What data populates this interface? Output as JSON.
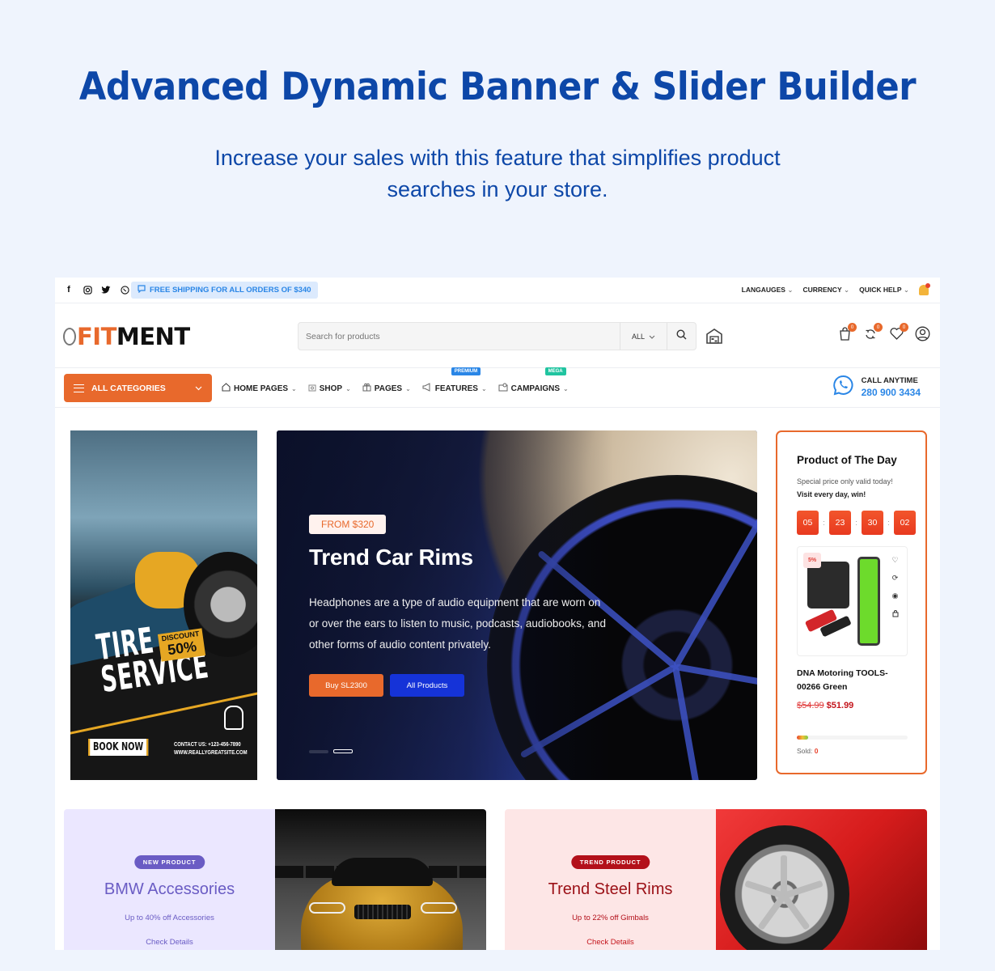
{
  "hero": {
    "title": "Advanced Dynamic Banner & Slider Builder",
    "subtitle": "Increase your sales with this feature that simplifies product searches in your store."
  },
  "topbar": {
    "social_icons": [
      "facebook-icon",
      "instagram-icon",
      "twitter-icon",
      "viber-icon"
    ],
    "shipping_notice": "FREE SHIPPING FOR ALL ORDERS OF $340",
    "menus": [
      "LANGAUGES",
      "CURRENCY",
      "QUICK HELP"
    ]
  },
  "header": {
    "logo_accent": "FIT",
    "logo_rest": "MENT",
    "search_placeholder": "Search for products",
    "search_category": "ALL",
    "cart_count": "0",
    "compare_count": "0",
    "wishlist_count": "0"
  },
  "nav": {
    "all_categories": "ALL CATEGORIES",
    "items": [
      {
        "label": "HOME PAGES",
        "tag": ""
      },
      {
        "label": "SHOP",
        "tag": ""
      },
      {
        "label": "PAGES",
        "tag": ""
      },
      {
        "label": "FEATURES",
        "tag": "PREMIUM"
      },
      {
        "label": "CAMPAIGNS",
        "tag": "MEGA"
      }
    ],
    "call_label": "CALL ANYTIME",
    "call_number": "280 900 3434"
  },
  "left_banner": {
    "title_line1": "TIRE",
    "title_line2": "SERVICE",
    "discount_label": "DISCOUNT",
    "discount_value": "50%",
    "book_now": "BOOK NOW",
    "contact_line1": "CONTACT US: +123-456-7890",
    "contact_line2": "WWW.REALLYGREATSITE.COM"
  },
  "slider": {
    "price_tag": "FROM $320",
    "title": "Trend Car Rims",
    "description": "Headphones are a type of audio equipment that are worn on or over the ears to listen to music, podcasts, audiobooks, and other forms of audio content privately.",
    "primary_button": "Buy SL2300",
    "secondary_button": "All Products",
    "slide_count": 2,
    "active_slide": 2
  },
  "product_of_day": {
    "heading": "Product of The Day",
    "line1": "Special price only valid today!",
    "line2": "Visit every day, win!",
    "countdown": [
      "05",
      "23",
      "30",
      "02"
    ],
    "discount_badge": "5%",
    "product_name": "DNA Motoring TOOLS-00266 Green",
    "old_price": "$54.99",
    "new_price": "$51.99",
    "sold_label": "Sold:",
    "sold_count": "0",
    "sold_progress": 0.1
  },
  "bottom_banners": [
    {
      "tag": "NEW PRODUCT",
      "title": "BMW Accessories",
      "subtitle": "Up to 40% off Accessories",
      "link": "Check Details"
    },
    {
      "tag": "TREND PRODUCT",
      "title": "Trend Steel Rims",
      "subtitle": "Up to 22% off Gimbals",
      "link": "Check Details"
    }
  ],
  "colors": {
    "brand_orange": "#e8692c",
    "hero_blue": "#0d47a8",
    "link_blue": "#2a86e6",
    "premium_tag": "#2a86e6",
    "mega_tag": "#20c4a0",
    "bmw_purple": "#6a5cc4",
    "trend_red": "#b3101a"
  }
}
